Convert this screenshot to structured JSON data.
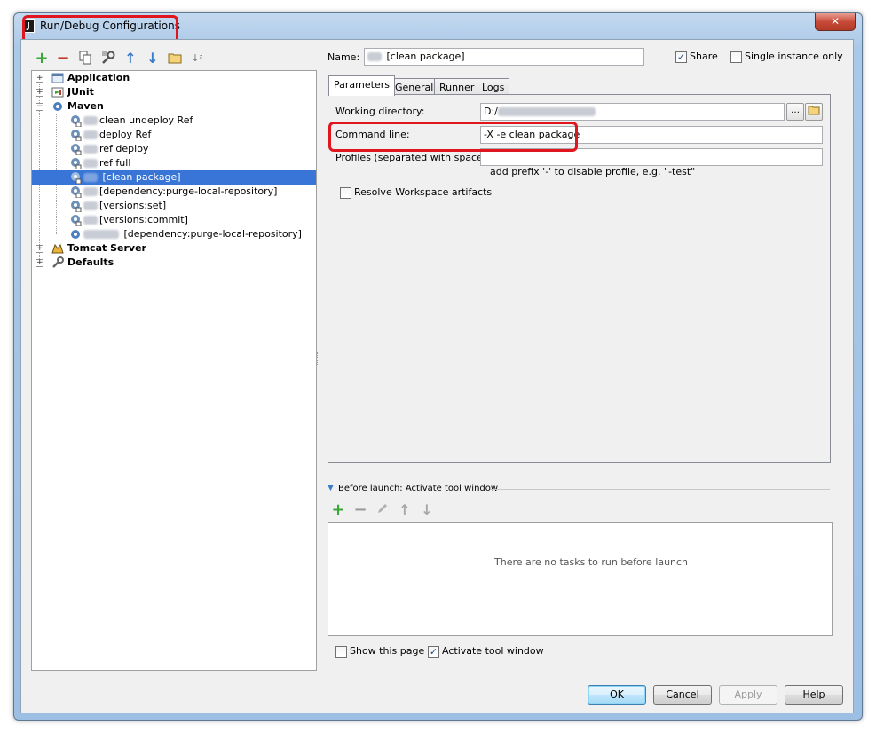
{
  "window": {
    "title": "Run/Debug Configurations",
    "app_icon": "J",
    "close_glyph": "✕"
  },
  "toolbar": {
    "icons": [
      "add-icon",
      "remove-icon",
      "copy-icon",
      "edit-defaults-icon",
      "move-up-icon",
      "move-down-icon",
      "folder-icon",
      "sort-icon"
    ],
    "add_glyph": "+",
    "remove_glyph": "−",
    "up_glyph": "↑",
    "down_glyph": "↓",
    "sort_glyph": "↓ᶻ"
  },
  "tree": {
    "groups": [
      {
        "label": "Application",
        "expanded": false
      },
      {
        "label": "JUnit",
        "expanded": false
      },
      {
        "label": "Maven",
        "expanded": true
      },
      {
        "label": "Tomcat Server",
        "expanded": false
      },
      {
        "label": "Defaults",
        "expanded": false
      }
    ],
    "maven_items": [
      {
        "label": "clean undeploy Ref",
        "selected": false
      },
      {
        "label": "deploy Ref",
        "selected": false
      },
      {
        "label": "ref deploy",
        "selected": false
      },
      {
        "label": "ref full",
        "selected": false
      },
      {
        "label": "[clean package]",
        "selected": true
      },
      {
        "label": "[dependency:purge-local-repository]",
        "selected": false
      },
      {
        "label": "[versions:set]",
        "selected": false
      },
      {
        "label": "[versions:commit]",
        "selected": false
      },
      {
        "label": "[dependency:purge-local-repository]",
        "selected": false
      }
    ],
    "expand_glyph": "+",
    "collapse_glyph": "−"
  },
  "config": {
    "name_label": "Name:",
    "name_value": "[clean package]",
    "share_label": "Share",
    "share_checked": true,
    "single_instance_label": "Single instance only",
    "single_instance_checked": false
  },
  "tabs": [
    {
      "label": "Parameters",
      "active": true
    },
    {
      "label": "General",
      "active": false
    },
    {
      "label": "Runner",
      "active": false
    },
    {
      "label": "Logs",
      "active": false
    }
  ],
  "parameters": {
    "working_dir_label": "Working directory:",
    "working_dir_value": "D:/",
    "browse_glyph": "…",
    "command_line_label": "Command line:",
    "command_line_value": "-X -e clean package",
    "profiles_label": "Profiles (separated with space):",
    "profiles_value": "",
    "profiles_hint": "add prefix '-' to disable profile, e.g. \"-test\"",
    "resolve_workspace_label": "Resolve Workspace artifacts",
    "resolve_workspace_checked": false
  },
  "before_launch": {
    "header": "Before launch: Activate tool window",
    "empty_text": "There are no tasks to run before launch",
    "show_page_label": "Show this page",
    "show_page_checked": false,
    "activate_window_label": "Activate tool window",
    "activate_window_checked": true
  },
  "buttons": {
    "ok": "OK",
    "cancel": "Cancel",
    "apply": "Apply",
    "help": "Help"
  },
  "check_glyph": "✓",
  "colors": {
    "highlight": "#e0161e",
    "selection": "#3875d7",
    "add_green": "#3aa636",
    "remove_red": "#c0392b",
    "arrow_blue": "#3b7cc6"
  }
}
